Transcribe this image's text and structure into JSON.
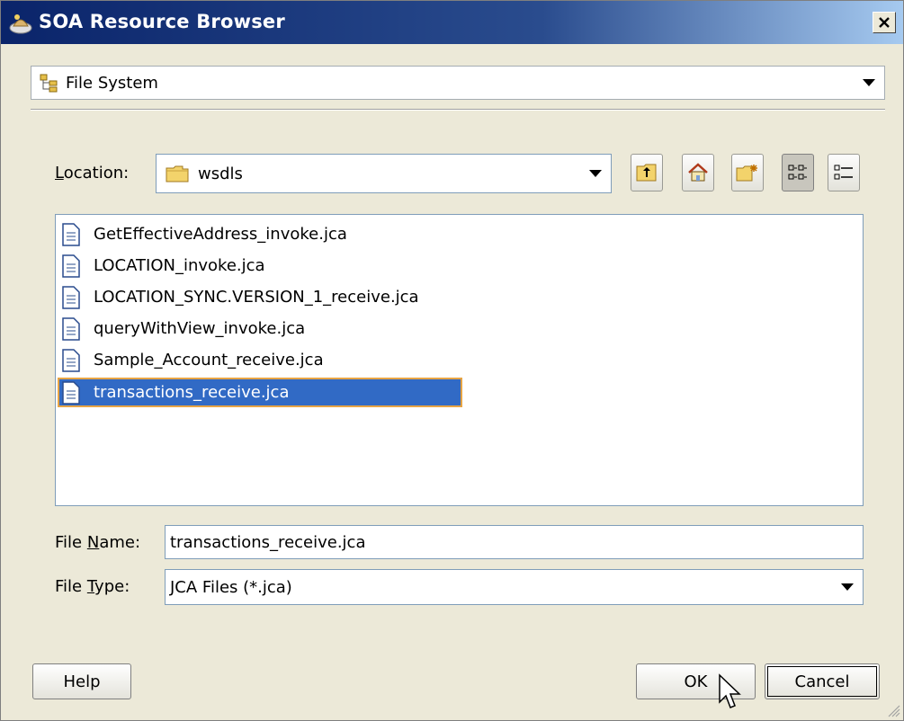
{
  "window": {
    "title": "SOA Resource Browser"
  },
  "source": {
    "selected": "File System"
  },
  "location": {
    "label": "Location:",
    "value": "wsdls"
  },
  "files": [
    {
      "name": "GetEffectiveAddress_invoke.jca",
      "selected": false
    },
    {
      "name": "LOCATION_invoke.jca",
      "selected": false
    },
    {
      "name": "LOCATION_SYNC.VERSION_1_receive.jca",
      "selected": false
    },
    {
      "name": "queryWithView_invoke.jca",
      "selected": false
    },
    {
      "name": "Sample_Account_receive.jca",
      "selected": false
    },
    {
      "name": "transactions_receive.jca",
      "selected": true
    }
  ],
  "file_name": {
    "label": "File Name:",
    "value": "transactions_receive.jca"
  },
  "file_type": {
    "label": "File Type:",
    "value": "JCA Files (*.jca)"
  },
  "buttons": {
    "help": "Help",
    "ok": "OK",
    "cancel": "Cancel"
  },
  "icons": [
    "soa-app-icon",
    "close-icon",
    "file-system-icon",
    "folder-icon",
    "up-folder-icon",
    "home-icon",
    "new-folder-icon",
    "list-view-icon",
    "details-view-icon",
    "document-icon",
    "mouse-cursor-icon",
    "resize-grip-icon"
  ],
  "colors": {
    "titlebar": "#0a246a",
    "selection": "#316ac5",
    "dialog_bg": "#ece9d8"
  }
}
